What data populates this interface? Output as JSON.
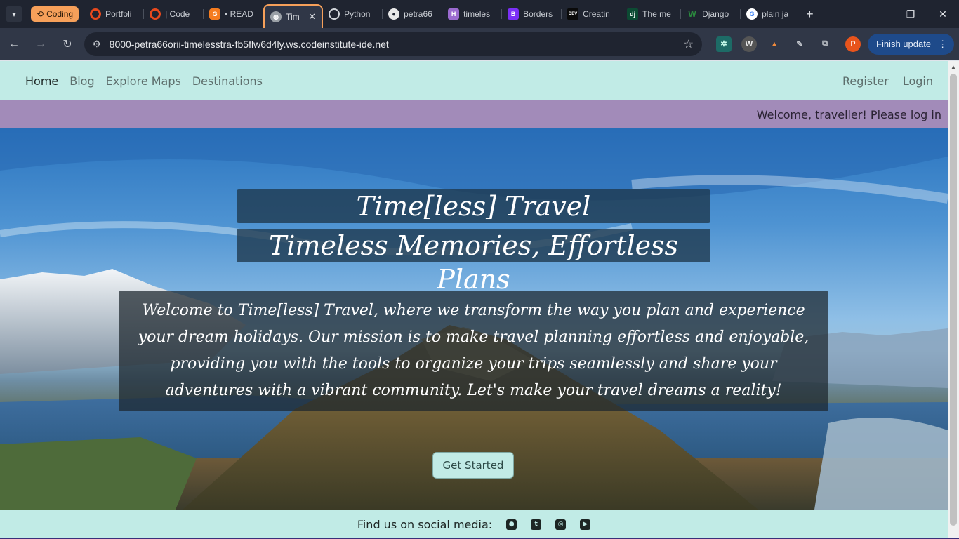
{
  "browser": {
    "tab_group": {
      "label": "Coding",
      "color": "#f6a05a"
    },
    "tabs": [
      {
        "label": "Portfoli",
        "icon": "opera-o-icon",
        "color": "#e8491d"
      },
      {
        "label": "| Code",
        "icon": "opera-o-icon",
        "color": "#e8491d"
      },
      {
        "label": "• READ",
        "icon": "gitpod-icon",
        "color": "#f57c1f"
      },
      {
        "label": "Tim",
        "icon": "globe-icon",
        "color": "#9aa0a6",
        "active": true
      },
      {
        "label": "Python",
        "icon": "openai-icon",
        "color": "#cfd3d8"
      },
      {
        "label": "petra66",
        "icon": "github-icon",
        "color": "#e8e8e8"
      },
      {
        "label": "timeles",
        "icon": "heroku-icon",
        "color": "#9b6bd0"
      },
      {
        "label": "Borders",
        "icon": "bootstrap-icon",
        "color": "#7b2ff7"
      },
      {
        "label": "Creatin",
        "icon": "dev-icon",
        "color": "#0a0a0a"
      },
      {
        "label": "The me",
        "icon": "django-icon",
        "color": "#0c4b33"
      },
      {
        "label": "Django",
        "icon": "w-icon",
        "color": "#2b8a3e"
      },
      {
        "label": "plain ja",
        "icon": "google-icon",
        "color": "#ffffff"
      }
    ],
    "url": "8000-petra66orii-timelesstra-fb5flw6d4ly.ws.codeinstitute-ide.net",
    "profile_initial": "P",
    "update_label": "Finish update"
  },
  "site": {
    "nav": {
      "home": "Home",
      "blog": "Blog",
      "explore_maps": "Explore Maps",
      "destinations": "Destinations",
      "register": "Register",
      "login": "Login"
    },
    "welcome_message": "Welcome, traveller! Please log in",
    "hero": {
      "title": "Time[less] Travel",
      "subtitle": "Timeless Memories, Effortless Plans",
      "intro": "Welcome to Time[less] Travel, where we transform the way you plan and experience your dream holidays. Our mission is to make travel planning effortless and enjoyable, providing you with the tools to organize your trips seamlessly and share your adventures with a vibrant community. Let's make your travel dreams a reality!",
      "cta_label": "Get Started"
    },
    "footer": {
      "label": "Find us on social media:",
      "social_icons": [
        "github-icon",
        "twitter-icon",
        "instagram-icon",
        "youtube-icon"
      ]
    }
  },
  "colors": {
    "nav_bg": "#c1ebe6",
    "welcome_bar_bg": "#a28bb9",
    "chrome_bg": "#1f2430",
    "toolbar_bg": "#303747",
    "update_button_bg": "#1e4a8a"
  }
}
